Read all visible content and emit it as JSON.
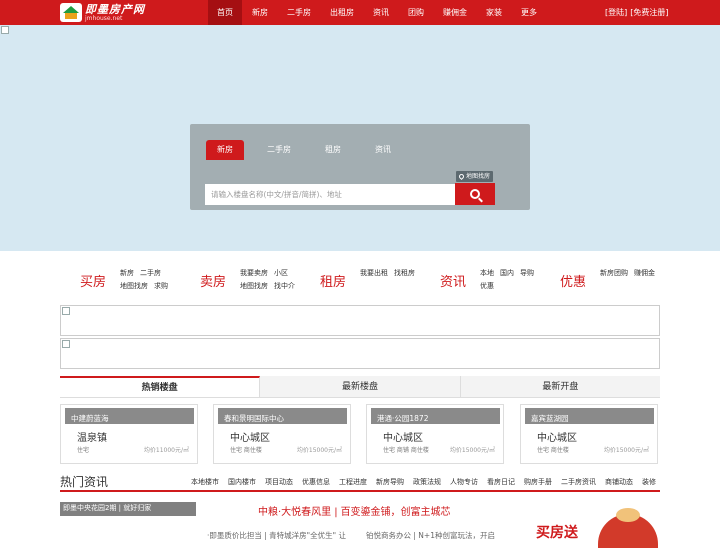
{
  "logo": {
    "name": "即墨房产网",
    "domain": "jmhouse.net"
  },
  "nav": {
    "items": [
      {
        "label": "首页",
        "active": true
      },
      {
        "label": "新房",
        "active": false
      },
      {
        "label": "二手房",
        "active": false
      },
      {
        "label": "出租房",
        "active": false
      },
      {
        "label": "资讯",
        "active": false
      },
      {
        "label": "团购",
        "active": false
      },
      {
        "label": "赚佣金",
        "active": false
      },
      {
        "label": "家装",
        "active": false
      },
      {
        "label": "更多",
        "active": false
      }
    ],
    "login": "[登陆]",
    "register": "[免费注册]"
  },
  "search": {
    "tabs": [
      "新房",
      "二手房",
      "租房",
      "资讯"
    ],
    "active_tab": 0,
    "map_find": "地图找房",
    "placeholder": "请输入楼盘名称(中文/拼音/简拼)、地址"
  },
  "categories": [
    {
      "title": "买房",
      "links": [
        "新房",
        "二手房",
        "地图找房",
        "求购"
      ]
    },
    {
      "title": "卖房",
      "links": [
        "我要卖房",
        "小区",
        "地图找房",
        "找中介"
      ]
    },
    {
      "title": "租房",
      "links": [
        "我要出租",
        "找租房"
      ]
    },
    {
      "title": "资讯",
      "links": [
        "本地",
        "国内",
        "导购",
        "优惠"
      ]
    },
    {
      "title": "优惠",
      "links": [
        "新房团购",
        "赚佣金"
      ]
    }
  ],
  "listing_tabs": [
    "热销楼盘",
    "最新楼盘",
    "最新开盘"
  ],
  "listing_active": 0,
  "listings": [
    {
      "name": "中建蔚蓝海",
      "district": "温泉镇",
      "type": "住宅",
      "price": "均价11000元/㎡"
    },
    {
      "name": "春和景明国际中心",
      "district": "中心城区",
      "type": "住宅 商住楼",
      "price": "均价15000元/㎡"
    },
    {
      "name": "港通·公园1872",
      "district": "中心城区",
      "type": "住宅 商铺 商住楼",
      "price": "均价15000元/㎡"
    },
    {
      "name": "嘉宾蓝湖园",
      "district": "中心城区",
      "type": "住宅 商住楼",
      "price": "均价15000元/㎡"
    }
  ],
  "news": {
    "title": "热门资讯",
    "tags": [
      "本地楼市",
      "国内楼市",
      "项目动态",
      "优惠信息",
      "工程进度",
      "新房导购",
      "政策法规",
      "人物专访",
      "看房日记",
      "购房手册",
      "二手房资讯",
      "商铺动态",
      "装修"
    ],
    "thumb_caption": "即墨中央花园2期 | 就好归家",
    "headline_a": "中粮·大悦春风里",
    "headline_sep": "|",
    "headline_b": "百变鎏金铺，创富主城芯",
    "line_1": "·即墨质价比担当 | 青特城洋房\"全优生\" 让",
    "line_2": "铂悦商务办公 | N+1种创富玩法，开启",
    "promo": "买房送"
  },
  "colors": {
    "brand": "#cf1a1c",
    "hero_bg": "#d6e8f2",
    "search_panel": "#a3aeb2"
  }
}
